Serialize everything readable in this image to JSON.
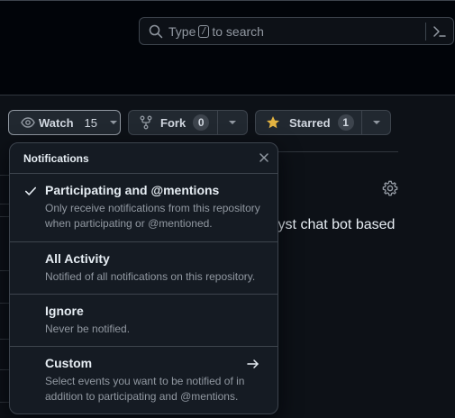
{
  "search": {
    "prefix": "Type",
    "key": "/",
    "suffix": "to search"
  },
  "repo_actions": {
    "watch": {
      "label": "Watch",
      "count": "15"
    },
    "fork": {
      "label": "Fork",
      "count": "0"
    },
    "star": {
      "label": "Starred",
      "count": "1"
    }
  },
  "background": {
    "about_fragment": "lyst chat bot based"
  },
  "notifications": {
    "title": "Notifications",
    "items": [
      {
        "title": "Participating and @mentions",
        "desc": "Only receive notifications from this repository when participating or @mentioned.",
        "selected": true
      },
      {
        "title": "All Activity",
        "desc": "Notified of all notifications on this repository.",
        "selected": false
      },
      {
        "title": "Ignore",
        "desc": "Never be notified.",
        "selected": false
      },
      {
        "title": "Custom",
        "desc": "Select events you want to be notified of in addition to participating and @mentions.",
        "selected": false
      }
    ]
  },
  "icons": [
    "search-icon",
    "command-palette-icon",
    "eye-icon",
    "triangle-down-icon",
    "repo-forked-icon",
    "star-fill-icon",
    "gear-icon",
    "x-icon",
    "check-icon",
    "arrow-right-icon"
  ],
  "colors": {
    "background": "#0d1117",
    "header": "#010409",
    "star": "#e3b341",
    "panel": "#151b23"
  }
}
